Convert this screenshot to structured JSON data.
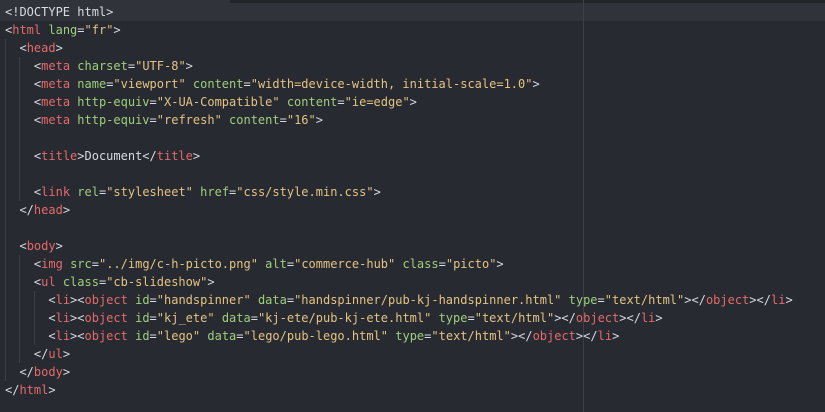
{
  "colors": {
    "background": "#272a30",
    "tag": "#e46a6a",
    "attribute": "#9fce7c",
    "string": "#e3c383",
    "text": "#d7dae0"
  },
  "lines": [
    [
      {
        "t": "doctype",
        "v": "<!DOCTYPE html>"
      }
    ],
    [
      {
        "t": "punct",
        "v": "<"
      },
      {
        "t": "tag",
        "v": "html"
      },
      {
        "t": "text",
        "v": " "
      },
      {
        "t": "attr",
        "v": "lang"
      },
      {
        "t": "punct",
        "v": "="
      },
      {
        "t": "str",
        "v": "\"fr\""
      },
      {
        "t": "punct",
        "v": ">"
      }
    ],
    [
      {
        "t": "text",
        "v": "  "
      },
      {
        "t": "punct",
        "v": "<"
      },
      {
        "t": "tag",
        "v": "head"
      },
      {
        "t": "punct",
        "v": ">"
      }
    ],
    [
      {
        "t": "text",
        "v": "    "
      },
      {
        "t": "punct",
        "v": "<"
      },
      {
        "t": "tag",
        "v": "meta"
      },
      {
        "t": "text",
        "v": " "
      },
      {
        "t": "attr",
        "v": "charset"
      },
      {
        "t": "punct",
        "v": "="
      },
      {
        "t": "str",
        "v": "\"UTF-8\""
      },
      {
        "t": "punct",
        "v": ">"
      }
    ],
    [
      {
        "t": "text",
        "v": "    "
      },
      {
        "t": "punct",
        "v": "<"
      },
      {
        "t": "tag",
        "v": "meta"
      },
      {
        "t": "text",
        "v": " "
      },
      {
        "t": "attr",
        "v": "name"
      },
      {
        "t": "punct",
        "v": "="
      },
      {
        "t": "str",
        "v": "\"viewport\""
      },
      {
        "t": "text",
        "v": " "
      },
      {
        "t": "attr",
        "v": "content"
      },
      {
        "t": "punct",
        "v": "="
      },
      {
        "t": "str",
        "v": "\"width=device-width, initial-scale=1.0\""
      },
      {
        "t": "punct",
        "v": ">"
      }
    ],
    [
      {
        "t": "text",
        "v": "    "
      },
      {
        "t": "punct",
        "v": "<"
      },
      {
        "t": "tag",
        "v": "meta"
      },
      {
        "t": "text",
        "v": " "
      },
      {
        "t": "attr",
        "v": "http-equiv"
      },
      {
        "t": "punct",
        "v": "="
      },
      {
        "t": "str",
        "v": "\"X-UA-Compatible\""
      },
      {
        "t": "text",
        "v": " "
      },
      {
        "t": "attr",
        "v": "content"
      },
      {
        "t": "punct",
        "v": "="
      },
      {
        "t": "str",
        "v": "\"ie=edge\""
      },
      {
        "t": "punct",
        "v": ">"
      }
    ],
    [
      {
        "t": "text",
        "v": "    "
      },
      {
        "t": "punct",
        "v": "<"
      },
      {
        "t": "tag",
        "v": "meta"
      },
      {
        "t": "text",
        "v": " "
      },
      {
        "t": "attr",
        "v": "http-equiv"
      },
      {
        "t": "punct",
        "v": "="
      },
      {
        "t": "str",
        "v": "\"refresh\""
      },
      {
        "t": "text",
        "v": " "
      },
      {
        "t": "attr",
        "v": "content"
      },
      {
        "t": "punct",
        "v": "="
      },
      {
        "t": "str",
        "v": "\"16\""
      },
      {
        "t": "punct",
        "v": ">"
      }
    ],
    [],
    [
      {
        "t": "text",
        "v": "    "
      },
      {
        "t": "punct",
        "v": "<"
      },
      {
        "t": "tag",
        "v": "title"
      },
      {
        "t": "punct",
        "v": ">"
      },
      {
        "t": "text",
        "v": "Document"
      },
      {
        "t": "punct",
        "v": "</"
      },
      {
        "t": "tag",
        "v": "title"
      },
      {
        "t": "punct",
        "v": ">"
      }
    ],
    [],
    [
      {
        "t": "text",
        "v": "    "
      },
      {
        "t": "punct",
        "v": "<"
      },
      {
        "t": "tag",
        "v": "link"
      },
      {
        "t": "text",
        "v": " "
      },
      {
        "t": "attr",
        "v": "rel"
      },
      {
        "t": "punct",
        "v": "="
      },
      {
        "t": "str",
        "v": "\"stylesheet\""
      },
      {
        "t": "text",
        "v": " "
      },
      {
        "t": "attr",
        "v": "href"
      },
      {
        "t": "punct",
        "v": "="
      },
      {
        "t": "str",
        "v": "\"css/style.min.css\""
      },
      {
        "t": "punct",
        "v": ">"
      }
    ],
    [
      {
        "t": "text",
        "v": "  "
      },
      {
        "t": "punct",
        "v": "</"
      },
      {
        "t": "tag",
        "v": "head"
      },
      {
        "t": "punct",
        "v": ">"
      }
    ],
    [],
    [
      {
        "t": "text",
        "v": "  "
      },
      {
        "t": "punct",
        "v": "<"
      },
      {
        "t": "tag",
        "v": "body"
      },
      {
        "t": "punct",
        "v": ">"
      }
    ],
    [
      {
        "t": "text",
        "v": "    "
      },
      {
        "t": "punct",
        "v": "<"
      },
      {
        "t": "tag",
        "v": "img"
      },
      {
        "t": "text",
        "v": " "
      },
      {
        "t": "attr",
        "v": "src"
      },
      {
        "t": "punct",
        "v": "="
      },
      {
        "t": "str",
        "v": "\"../img/c-h-picto.png\""
      },
      {
        "t": "text",
        "v": " "
      },
      {
        "t": "attr",
        "v": "alt"
      },
      {
        "t": "punct",
        "v": "="
      },
      {
        "t": "str",
        "v": "\"commerce-hub\""
      },
      {
        "t": "text",
        "v": " "
      },
      {
        "t": "attr",
        "v": "class"
      },
      {
        "t": "punct",
        "v": "="
      },
      {
        "t": "str",
        "v": "\"picto\""
      },
      {
        "t": "punct",
        "v": ">"
      }
    ],
    [
      {
        "t": "text",
        "v": "    "
      },
      {
        "t": "punct",
        "v": "<"
      },
      {
        "t": "tag",
        "v": "ul"
      },
      {
        "t": "text",
        "v": " "
      },
      {
        "t": "attr",
        "v": "class"
      },
      {
        "t": "punct",
        "v": "="
      },
      {
        "t": "str",
        "v": "\"cb-slideshow\""
      },
      {
        "t": "punct",
        "v": ">"
      }
    ],
    [
      {
        "t": "text",
        "v": "      "
      },
      {
        "t": "punct",
        "v": "<"
      },
      {
        "t": "tag",
        "v": "li"
      },
      {
        "t": "punct",
        "v": "><"
      },
      {
        "t": "tag",
        "v": "object"
      },
      {
        "t": "text",
        "v": " "
      },
      {
        "t": "attr",
        "v": "id"
      },
      {
        "t": "punct",
        "v": "="
      },
      {
        "t": "str",
        "v": "\"handspinner\""
      },
      {
        "t": "text",
        "v": " "
      },
      {
        "t": "attr",
        "v": "data"
      },
      {
        "t": "punct",
        "v": "="
      },
      {
        "t": "str",
        "v": "\"handspinner/pub-kj-handspinner.html\""
      },
      {
        "t": "text",
        "v": " "
      },
      {
        "t": "attr",
        "v": "type"
      },
      {
        "t": "punct",
        "v": "="
      },
      {
        "t": "str",
        "v": "\"text/html\""
      },
      {
        "t": "punct",
        "v": "></"
      },
      {
        "t": "tag",
        "v": "object"
      },
      {
        "t": "punct",
        "v": "></"
      },
      {
        "t": "tag",
        "v": "li"
      },
      {
        "t": "punct",
        "v": ">"
      }
    ],
    [
      {
        "t": "text",
        "v": "      "
      },
      {
        "t": "punct",
        "v": "<"
      },
      {
        "t": "tag",
        "v": "li"
      },
      {
        "t": "punct",
        "v": "><"
      },
      {
        "t": "tag",
        "v": "object"
      },
      {
        "t": "text",
        "v": " "
      },
      {
        "t": "attr",
        "v": "id"
      },
      {
        "t": "punct",
        "v": "="
      },
      {
        "t": "str",
        "v": "\"kj_ete\""
      },
      {
        "t": "text",
        "v": " "
      },
      {
        "t": "attr",
        "v": "data"
      },
      {
        "t": "punct",
        "v": "="
      },
      {
        "t": "str",
        "v": "\"kj-ete/pub-kj-ete.html\""
      },
      {
        "t": "text",
        "v": " "
      },
      {
        "t": "attr",
        "v": "type"
      },
      {
        "t": "punct",
        "v": "="
      },
      {
        "t": "str",
        "v": "\"text/html\""
      },
      {
        "t": "punct",
        "v": "></"
      },
      {
        "t": "tag",
        "v": "object"
      },
      {
        "t": "punct",
        "v": "></"
      },
      {
        "t": "tag",
        "v": "li"
      },
      {
        "t": "punct",
        "v": ">"
      }
    ],
    [
      {
        "t": "text",
        "v": "      "
      },
      {
        "t": "punct",
        "v": "<"
      },
      {
        "t": "tag",
        "v": "li"
      },
      {
        "t": "punct",
        "v": "><"
      },
      {
        "t": "tag",
        "v": "object"
      },
      {
        "t": "text",
        "v": " "
      },
      {
        "t": "attr",
        "v": "id"
      },
      {
        "t": "punct",
        "v": "="
      },
      {
        "t": "str",
        "v": "\"lego\""
      },
      {
        "t": "text",
        "v": " "
      },
      {
        "t": "attr",
        "v": "data"
      },
      {
        "t": "punct",
        "v": "="
      },
      {
        "t": "str",
        "v": "\"lego/pub-lego.html\""
      },
      {
        "t": "text",
        "v": " "
      },
      {
        "t": "attr",
        "v": "type"
      },
      {
        "t": "punct",
        "v": "="
      },
      {
        "t": "str",
        "v": "\"text/html\""
      },
      {
        "t": "punct",
        "v": "></"
      },
      {
        "t": "tag",
        "v": "object"
      },
      {
        "t": "punct",
        "v": "></"
      },
      {
        "t": "tag",
        "v": "li"
      },
      {
        "t": "punct",
        "v": ">"
      }
    ],
    [
      {
        "t": "text",
        "v": "    "
      },
      {
        "t": "punct",
        "v": "</"
      },
      {
        "t": "tag",
        "v": "ul"
      },
      {
        "t": "punct",
        "v": ">"
      }
    ],
    [
      {
        "t": "text",
        "v": "  "
      },
      {
        "t": "punct",
        "v": "</"
      },
      {
        "t": "tag",
        "v": "body"
      },
      {
        "t": "punct",
        "v": ">"
      }
    ],
    [
      {
        "t": "punct",
        "v": "</"
      },
      {
        "t": "tag",
        "v": "html"
      },
      {
        "t": "punct",
        "v": ">"
      }
    ]
  ]
}
